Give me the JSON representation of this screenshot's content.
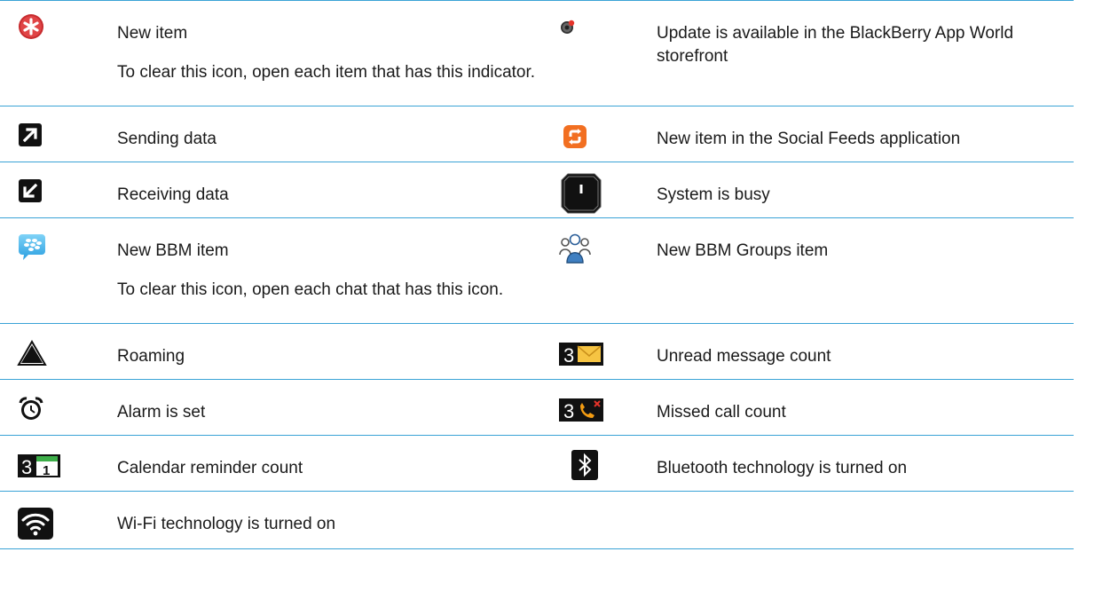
{
  "rows": [
    {
      "left": {
        "icon": "new-item-icon",
        "description": "New item",
        "note": "To clear this icon, open each item that has this indicator."
      },
      "right": {
        "icon": "app-update-icon",
        "description": "Update is available in the BlackBerry App World storefront"
      }
    },
    {
      "left": {
        "icon": "sending-data-icon",
        "description": "Sending data"
      },
      "right": {
        "icon": "social-feeds-icon",
        "description": "New item in the Social Feeds application"
      }
    },
    {
      "left": {
        "icon": "receiving-data-icon",
        "description": "Receiving data"
      },
      "right": {
        "icon": "system-busy-icon",
        "description": "System is busy"
      }
    },
    {
      "left": {
        "icon": "bbm-icon",
        "description": "New BBM item",
        "note": "To clear this icon, open each chat that has this icon."
      },
      "right": {
        "icon": "bbm-groups-icon",
        "description": "New BBM Groups item"
      }
    },
    {
      "left": {
        "icon": "roaming-icon",
        "description": "Roaming"
      },
      "right": {
        "icon": "unread-message-count-icon",
        "description": "Unread message count",
        "count": "3"
      }
    },
    {
      "left": {
        "icon": "alarm-icon",
        "description": "Alarm is set"
      },
      "right": {
        "icon": "missed-call-count-icon",
        "description": "Missed call count",
        "count": "3"
      }
    },
    {
      "left": {
        "icon": "calendar-reminder-count-icon",
        "description": "Calendar reminder count",
        "count": "3",
        "day": "1"
      },
      "right": {
        "icon": "bluetooth-icon",
        "description": "Bluetooth technology is turned on"
      }
    },
    {
      "left": {
        "icon": "wifi-icon",
        "description": "Wi-Fi technology is turned on"
      }
    }
  ],
  "colors": {
    "rule": "#3aa3d6",
    "new_item_red": "#d9383a",
    "social_feeds_orange": "#f26f21",
    "bbm_blue": "#3bb0e8",
    "bbm_groups_blue": "#3f7fc1",
    "envelope_yellow": "#f6c443",
    "calendar_green": "#3dae49",
    "missed_call_red": "#e5332a",
    "phone_orange": "#f39c12"
  }
}
